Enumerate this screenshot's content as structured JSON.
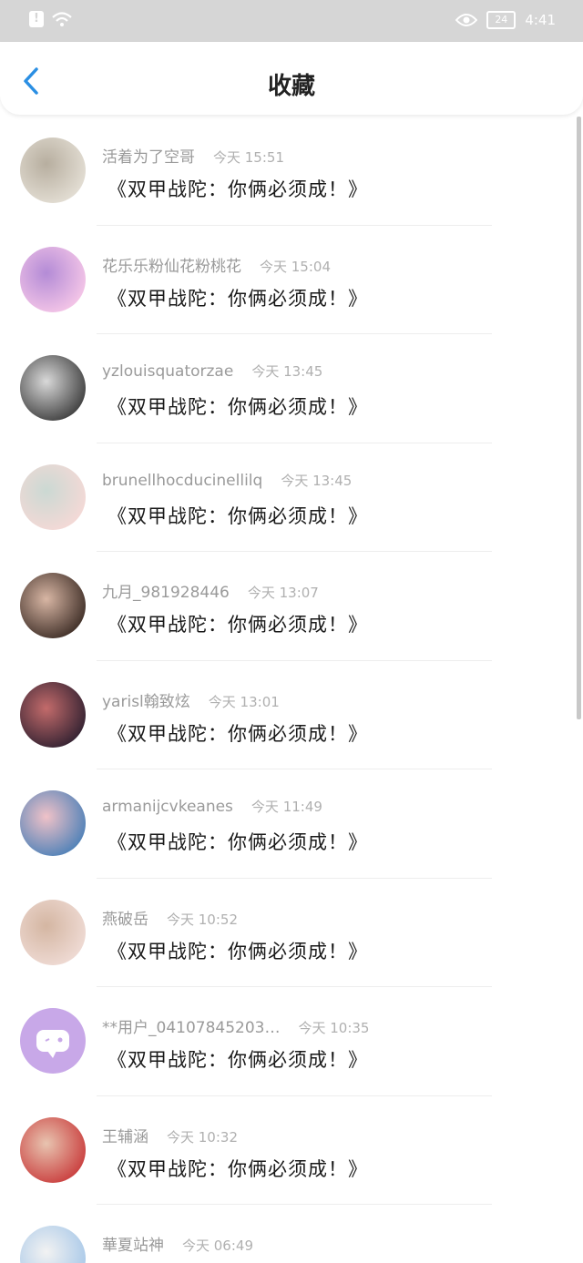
{
  "status": {
    "time": "4:41",
    "battery": "24"
  },
  "header": {
    "title": "收藏"
  },
  "items": [
    {
      "name": "活着为了空哥",
      "time": "今天 15:51",
      "content": "《双甲战陀：你俩必须成！》",
      "avatar_colors": [
        "#e5e0d6",
        "#b7ae9f"
      ]
    },
    {
      "name": "花乐乐粉仙花粉桃花",
      "time": "今天 15:04",
      "content": "《双甲战陀：你俩必须成！》",
      "avatar_colors": [
        "#f7c8e8",
        "#b38bd6"
      ]
    },
    {
      "name": "yzlouisquatorzae",
      "time": "今天 13:45",
      "content": "《双甲战陀：你俩必须成！》",
      "avatar_colors": [
        "#3b3b3b",
        "#d9d9d9"
      ]
    },
    {
      "name": "brunellhocducinellilq",
      "time": "今天 13:45",
      "content": "《双甲战陀：你俩必须成！》",
      "avatar_colors": [
        "#f6d9d6",
        "#cbd9d3"
      ]
    },
    {
      "name": "九月_981928446",
      "time": "今天 13:07",
      "content": "《双甲战陀：你俩必须成！》",
      "avatar_colors": [
        "#3b2b24",
        "#d8b6a4"
      ]
    },
    {
      "name": "yarisl翰致炫",
      "time": "今天 13:01",
      "content": "《双甲战陀：你俩必须成！》",
      "avatar_colors": [
        "#2f2030",
        "#c36b6b"
      ]
    },
    {
      "name": "armanijcvkeanes",
      "time": "今天 11:49",
      "content": "《双甲战陀：你俩必须成！》",
      "avatar_colors": [
        "#4a7fb7",
        "#f0c2c8"
      ]
    },
    {
      "name": "燕破岳",
      "time": "今天 10:52",
      "content": "《双甲战陀：你俩必须成！》",
      "avatar_colors": [
        "#f0dcd6",
        "#d4b6a2"
      ]
    },
    {
      "name": "**用户_04107845203…",
      "time": "今天 10:35",
      "content": "《双甲战陀：你俩必须成！》",
      "avatar_colors": [
        "#c8a8e8",
        "#c8a8e8"
      ]
    },
    {
      "name": "王辅涵",
      "time": "今天 10:32",
      "content": "《双甲战陀：你俩必须成！》",
      "avatar_colors": [
        "#c93b3b",
        "#e8c4b0"
      ]
    },
    {
      "name": "華夏站神",
      "time": "今天 06:49",
      "content": "",
      "avatar_colors": [
        "#a6c7e8",
        "#f2f2f2"
      ]
    }
  ],
  "icons": {
    "back": "chevron-left-icon",
    "eye": "eye-icon",
    "wifi": "wifi-icon",
    "warning": "warning-icon",
    "battery": "battery-icon",
    "default_avatar": "chat-bubble-icon"
  },
  "colors": {
    "accent": "#2b8fe3",
    "status_bar": "#d6d6d6"
  }
}
